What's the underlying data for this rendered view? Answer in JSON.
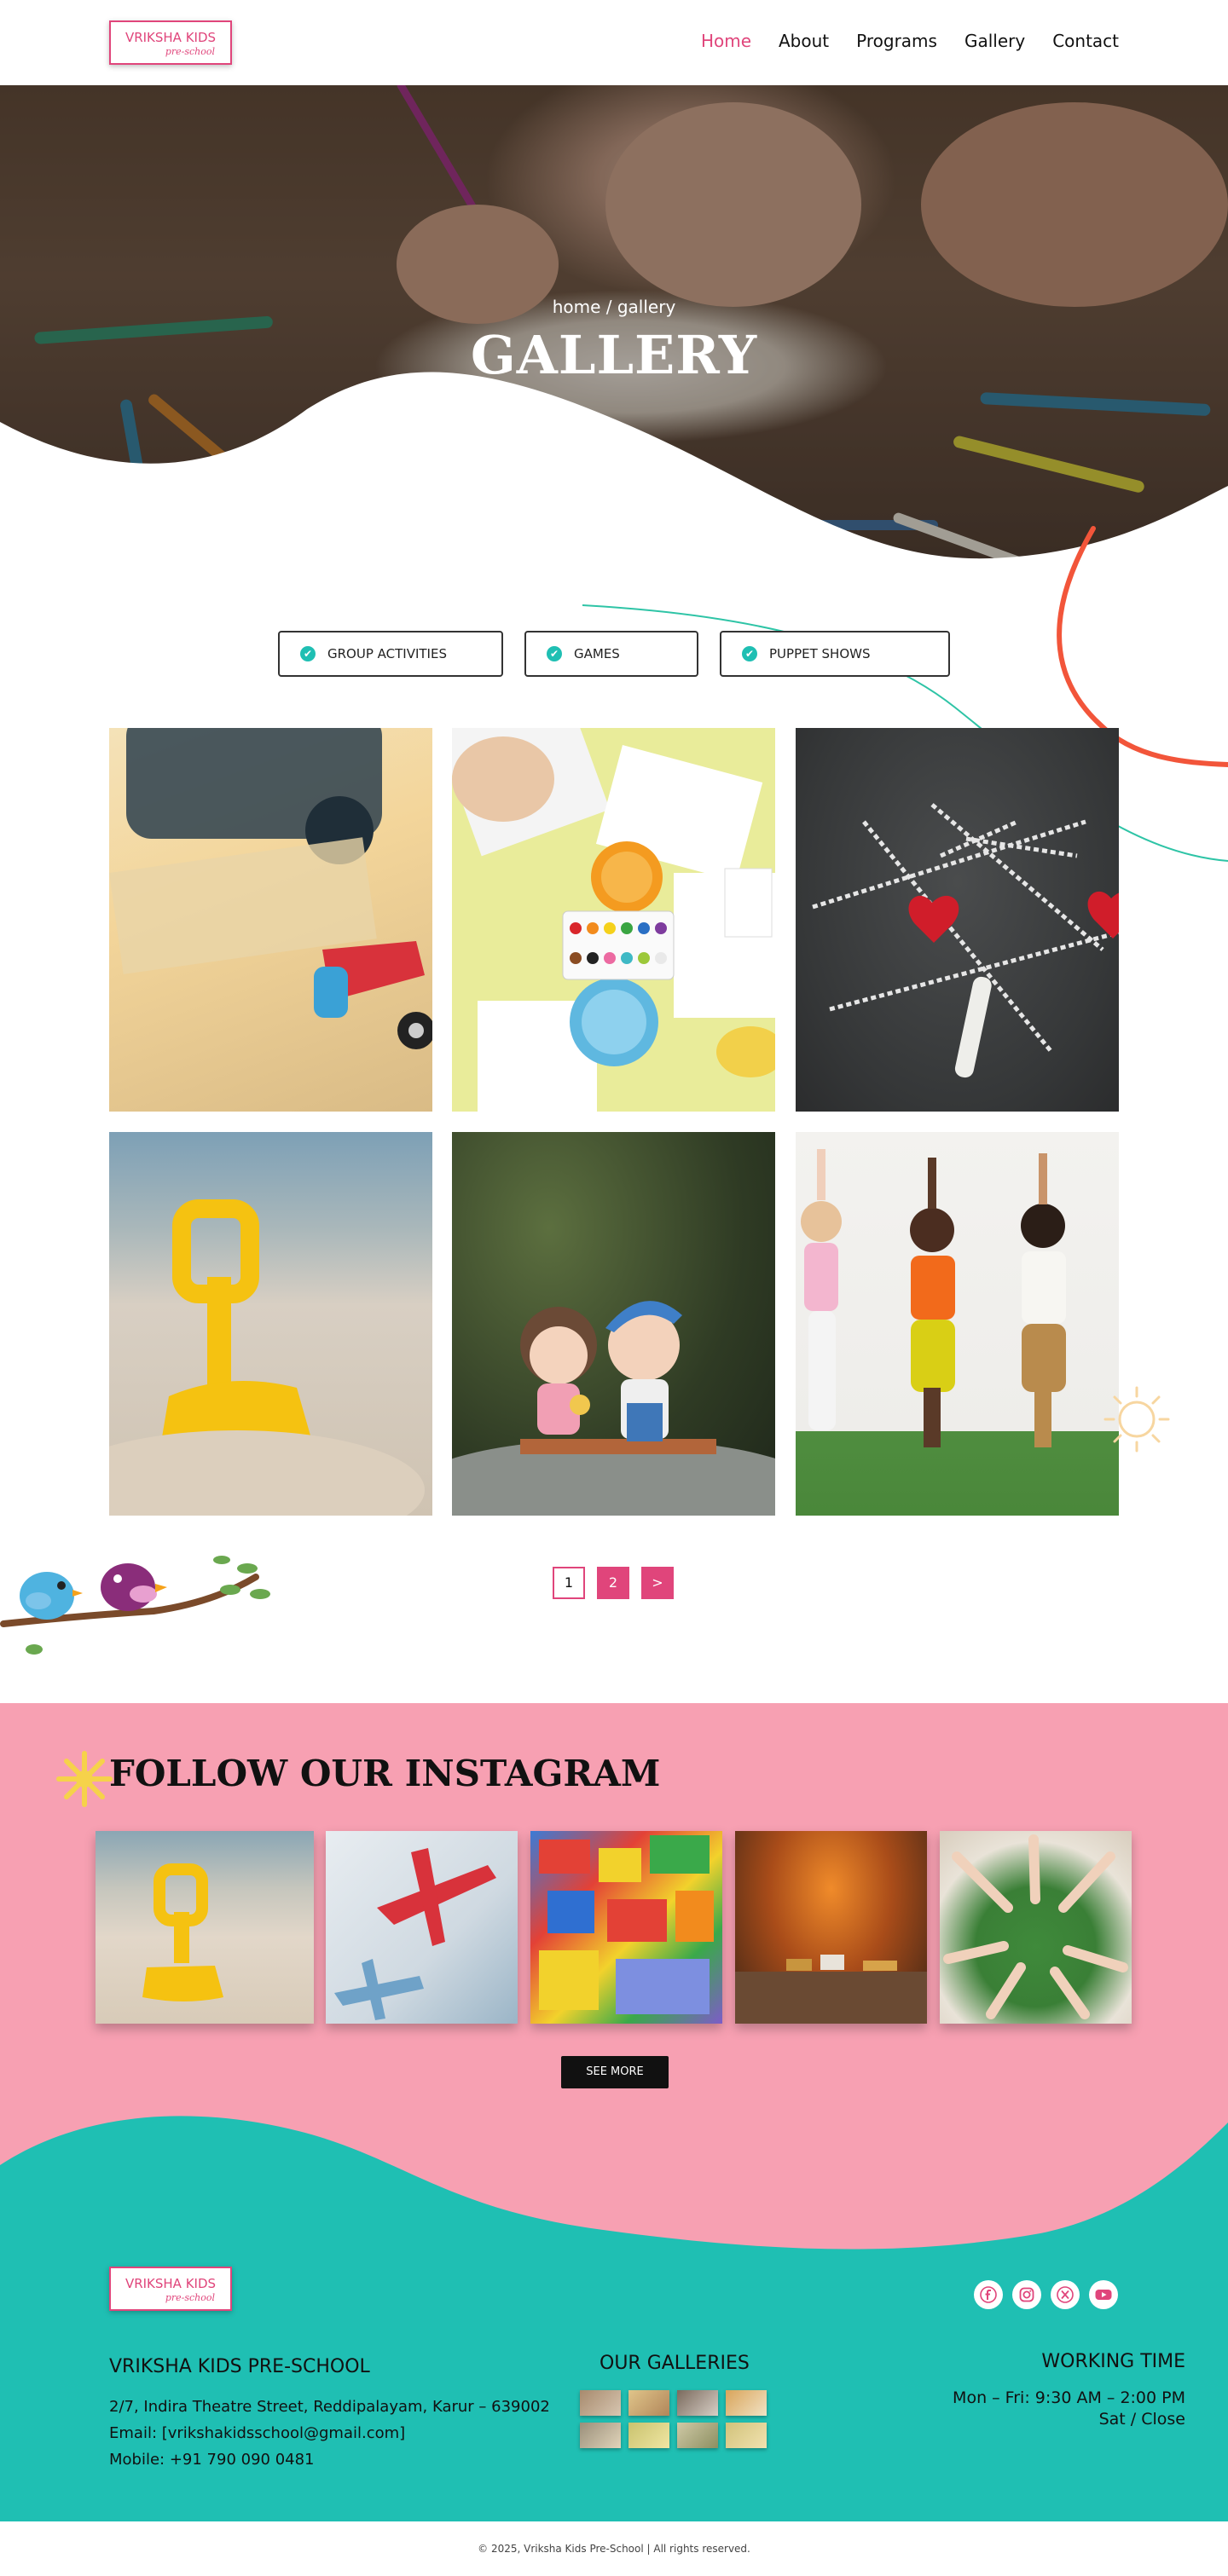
{
  "nav": {
    "logo": {
      "line1": "VRIKSHA KIDS",
      "line2": "pre-school"
    },
    "items": [
      {
        "label": "Home",
        "active": true
      },
      {
        "label": "About",
        "active": false
      },
      {
        "label": "Programs",
        "active": false
      },
      {
        "label": "Gallery",
        "active": false
      },
      {
        "label": "Contact",
        "active": false
      }
    ]
  },
  "hero": {
    "breadcrumb": "home / gallery",
    "title": "GALLERY"
  },
  "filters": [
    {
      "label": "GROUP ACTIVITIES"
    },
    {
      "label": "GAMES"
    },
    {
      "label": "PUPPET SHOWS"
    }
  ],
  "pagination": {
    "pages": [
      "1",
      "2"
    ],
    "current_page": "1",
    "next_label": ">"
  },
  "instagram": {
    "title": "FOLLOW OUR INSTAGRAM",
    "see_more": "SEE MORE"
  },
  "footer": {
    "logo": {
      "line1": "VRIKSHA KIDS",
      "line2": "pre-school"
    },
    "school_name": "VRIKSHA KIDS PRE-SCHOOL",
    "address": "2/7, Indira Theatre Street, Reddipalayam, Karur – 639002",
    "email": " Email: [vrikshakidsschool@gmail.com]",
    "mobile": "Mobile: +91 790 090 0481",
    "galleries_title": "OUR GALLERIES",
    "working_title": "WORKING TIME",
    "working_weekday": "Mon – Fri: 9:30 AM – 2:00 PM",
    "working_weekend": "Sat / Close",
    "social_icons": [
      "facebook-icon",
      "instagram-icon",
      "x-icon",
      "youtube-icon"
    ]
  },
  "copyright": "© 2025, Vriksha Kids Pre-School | All rights reserved.",
  "colors": {
    "accent_pink": "#e0457b",
    "insta_bg": "#f7a0b2",
    "footer_teal": "#1fbfb3",
    "check_teal": "#1fbfb3",
    "orange_curve": "#f2553a"
  }
}
